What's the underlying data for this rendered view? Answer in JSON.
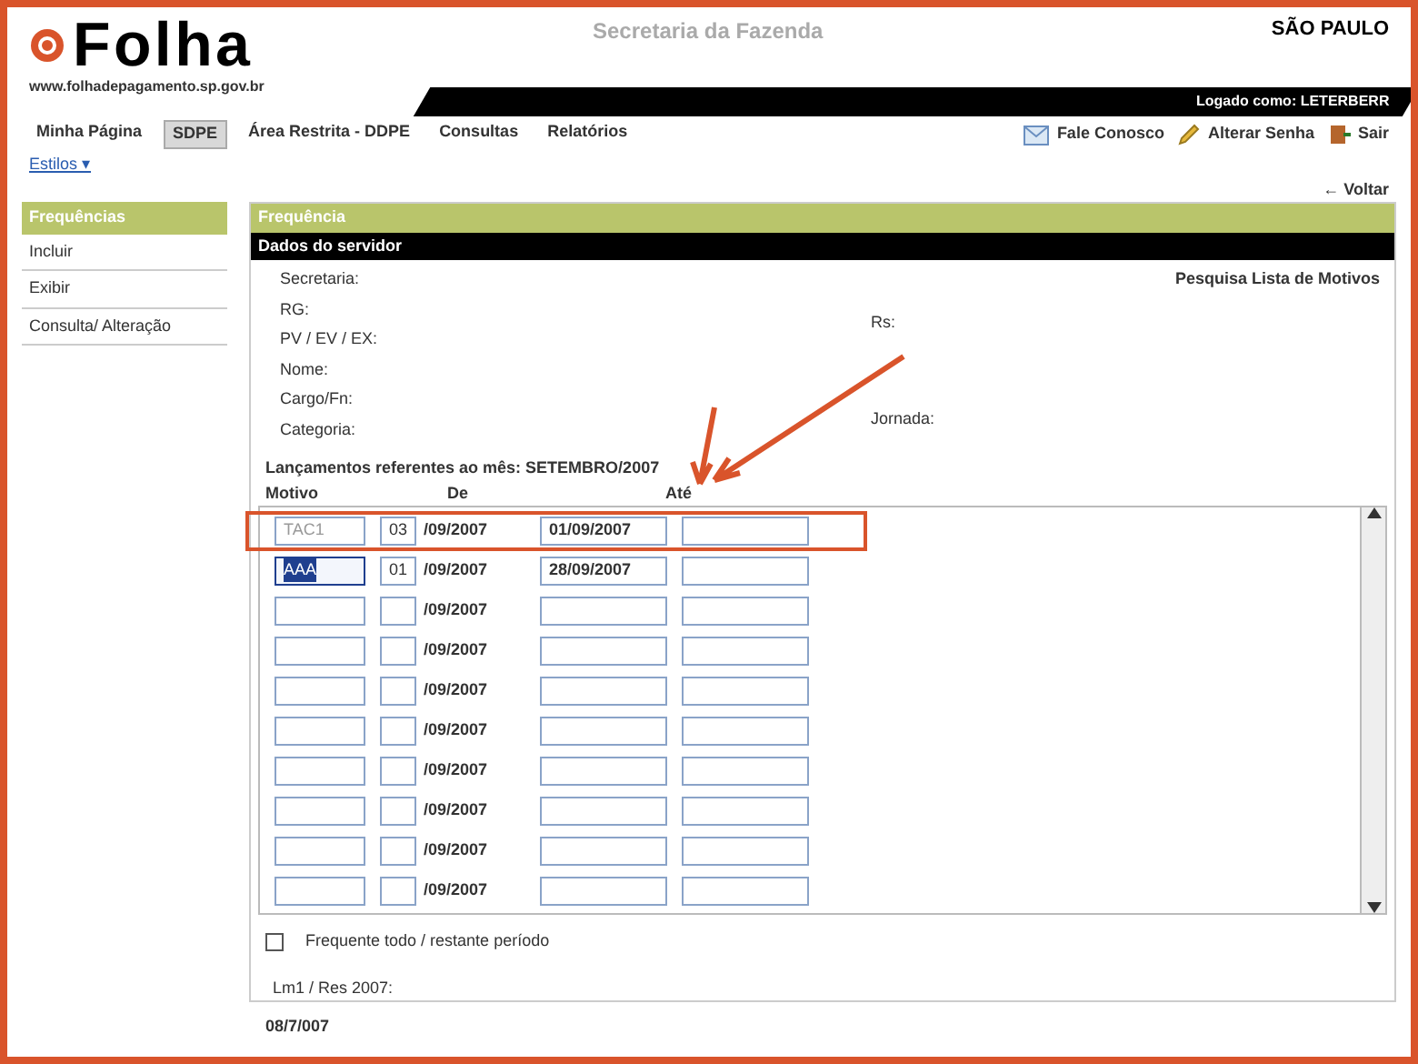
{
  "header": {
    "logo": "Folha",
    "url": "www.folhadepagamento.sp.gov.br",
    "title": "Secretaria da Fazenda",
    "state": "SÃO PAULO",
    "user": "Logado como: LETERBERR"
  },
  "menu": [
    {
      "label": "Minha Página",
      "selected": false
    },
    {
      "label": "SDPE",
      "selected": true
    },
    {
      "label": "Área Restrita - DDPE",
      "selected": false
    },
    {
      "label": "Consultas",
      "selected": false
    },
    {
      "label": "Relatórios",
      "selected": false
    }
  ],
  "actions": [
    {
      "label": "Fale Conosco",
      "kind": "mail"
    },
    {
      "label": "Alterar Senha",
      "kind": "edit"
    },
    {
      "label": "Sair",
      "kind": "exit"
    }
  ],
  "style_link": "Estilos ▾",
  "back": "← Voltar",
  "sidebar": {
    "title": "Frequências",
    "items": [
      {
        "label": "Incluir",
        "selected": false
      },
      {
        "label": "Exibir",
        "selected": false
      },
      {
        "label": "Consulta/ Alteração",
        "selected": false
      }
    ]
  },
  "panel": {
    "title": "Frequência",
    "section": "Dados do servidor",
    "search_link": "Pesquisa Lista de Motivos",
    "fields_left": [
      "Secretaria:",
      "RG:",
      "PV / EV / EX:",
      "Nome:",
      "Cargo/Fn:",
      "Categoria:"
    ],
    "fields_right": [
      "Rs:",
      "Jornada:"
    ],
    "period": "Lançamentos referentes ao mês: SETEMBRO/2007"
  },
  "table": {
    "columns": [
      "Motivo",
      "De",
      "Até"
    ],
    "rows": [
      {
        "motivo": "TAC1",
        "de": "03",
        "suffix": "/09/2007",
        "ate": "01/09/2007",
        "selected": false
      },
      {
        "motivo": "AAA",
        "de": "01",
        "suffix": "/09/2007",
        "ate": "28/09/2007",
        "selected": true
      },
      {
        "suffix": "/09/2007",
        "selected": false
      },
      {
        "suffix": "/09/2007",
        "selected": false
      },
      {
        "suffix": "/09/2007",
        "selected": false
      },
      {
        "suffix": "/09/2007",
        "selected": false
      },
      {
        "suffix": "/09/2007",
        "selected": false
      },
      {
        "suffix": "/09/2007",
        "selected": false
      },
      {
        "suffix": "/09/2007",
        "selected": false
      },
      {
        "suffix": "/09/2007",
        "selected": false
      }
    ]
  },
  "checkbox": {
    "label": "Frequente todo / restante período",
    "checked": false
  },
  "footer": {
    "label": "Lm1 / Res 2007:",
    "value": "08/7/007"
  }
}
